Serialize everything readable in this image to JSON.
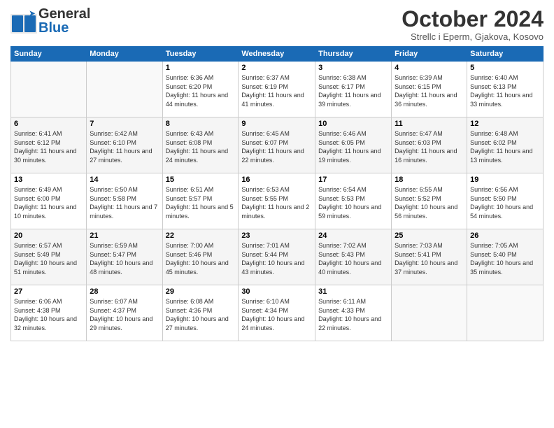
{
  "header": {
    "logo_main": "General",
    "logo_sub": "Blue",
    "month": "October 2024",
    "location": "Strellc i Eperm, Gjakova, Kosovo"
  },
  "days_of_week": [
    "Sunday",
    "Monday",
    "Tuesday",
    "Wednesday",
    "Thursday",
    "Friday",
    "Saturday"
  ],
  "weeks": [
    [
      {
        "day": "",
        "sunrise": "",
        "sunset": "",
        "daylight": ""
      },
      {
        "day": "",
        "sunrise": "",
        "sunset": "",
        "daylight": ""
      },
      {
        "day": "1",
        "sunrise": "Sunrise: 6:36 AM",
        "sunset": "Sunset: 6:20 PM",
        "daylight": "Daylight: 11 hours and 44 minutes."
      },
      {
        "day": "2",
        "sunrise": "Sunrise: 6:37 AM",
        "sunset": "Sunset: 6:19 PM",
        "daylight": "Daylight: 11 hours and 41 minutes."
      },
      {
        "day": "3",
        "sunrise": "Sunrise: 6:38 AM",
        "sunset": "Sunset: 6:17 PM",
        "daylight": "Daylight: 11 hours and 39 minutes."
      },
      {
        "day": "4",
        "sunrise": "Sunrise: 6:39 AM",
        "sunset": "Sunset: 6:15 PM",
        "daylight": "Daylight: 11 hours and 36 minutes."
      },
      {
        "day": "5",
        "sunrise": "Sunrise: 6:40 AM",
        "sunset": "Sunset: 6:13 PM",
        "daylight": "Daylight: 11 hours and 33 minutes."
      }
    ],
    [
      {
        "day": "6",
        "sunrise": "Sunrise: 6:41 AM",
        "sunset": "Sunset: 6:12 PM",
        "daylight": "Daylight: 11 hours and 30 minutes."
      },
      {
        "day": "7",
        "sunrise": "Sunrise: 6:42 AM",
        "sunset": "Sunset: 6:10 PM",
        "daylight": "Daylight: 11 hours and 27 minutes."
      },
      {
        "day": "8",
        "sunrise": "Sunrise: 6:43 AM",
        "sunset": "Sunset: 6:08 PM",
        "daylight": "Daylight: 11 hours and 24 minutes."
      },
      {
        "day": "9",
        "sunrise": "Sunrise: 6:45 AM",
        "sunset": "Sunset: 6:07 PM",
        "daylight": "Daylight: 11 hours and 22 minutes."
      },
      {
        "day": "10",
        "sunrise": "Sunrise: 6:46 AM",
        "sunset": "Sunset: 6:05 PM",
        "daylight": "Daylight: 11 hours and 19 minutes."
      },
      {
        "day": "11",
        "sunrise": "Sunrise: 6:47 AM",
        "sunset": "Sunset: 6:03 PM",
        "daylight": "Daylight: 11 hours and 16 minutes."
      },
      {
        "day": "12",
        "sunrise": "Sunrise: 6:48 AM",
        "sunset": "Sunset: 6:02 PM",
        "daylight": "Daylight: 11 hours and 13 minutes."
      }
    ],
    [
      {
        "day": "13",
        "sunrise": "Sunrise: 6:49 AM",
        "sunset": "Sunset: 6:00 PM",
        "daylight": "Daylight: 11 hours and 10 minutes."
      },
      {
        "day": "14",
        "sunrise": "Sunrise: 6:50 AM",
        "sunset": "Sunset: 5:58 PM",
        "daylight": "Daylight: 11 hours and 7 minutes."
      },
      {
        "day": "15",
        "sunrise": "Sunrise: 6:51 AM",
        "sunset": "Sunset: 5:57 PM",
        "daylight": "Daylight: 11 hours and 5 minutes."
      },
      {
        "day": "16",
        "sunrise": "Sunrise: 6:53 AM",
        "sunset": "Sunset: 5:55 PM",
        "daylight": "Daylight: 11 hours and 2 minutes."
      },
      {
        "day": "17",
        "sunrise": "Sunrise: 6:54 AM",
        "sunset": "Sunset: 5:53 PM",
        "daylight": "Daylight: 10 hours and 59 minutes."
      },
      {
        "day": "18",
        "sunrise": "Sunrise: 6:55 AM",
        "sunset": "Sunset: 5:52 PM",
        "daylight": "Daylight: 10 hours and 56 minutes."
      },
      {
        "day": "19",
        "sunrise": "Sunrise: 6:56 AM",
        "sunset": "Sunset: 5:50 PM",
        "daylight": "Daylight: 10 hours and 54 minutes."
      }
    ],
    [
      {
        "day": "20",
        "sunrise": "Sunrise: 6:57 AM",
        "sunset": "Sunset: 5:49 PM",
        "daylight": "Daylight: 10 hours and 51 minutes."
      },
      {
        "day": "21",
        "sunrise": "Sunrise: 6:59 AM",
        "sunset": "Sunset: 5:47 PM",
        "daylight": "Daylight: 10 hours and 48 minutes."
      },
      {
        "day": "22",
        "sunrise": "Sunrise: 7:00 AM",
        "sunset": "Sunset: 5:46 PM",
        "daylight": "Daylight: 10 hours and 45 minutes."
      },
      {
        "day": "23",
        "sunrise": "Sunrise: 7:01 AM",
        "sunset": "Sunset: 5:44 PM",
        "daylight": "Daylight: 10 hours and 43 minutes."
      },
      {
        "day": "24",
        "sunrise": "Sunrise: 7:02 AM",
        "sunset": "Sunset: 5:43 PM",
        "daylight": "Daylight: 10 hours and 40 minutes."
      },
      {
        "day": "25",
        "sunrise": "Sunrise: 7:03 AM",
        "sunset": "Sunset: 5:41 PM",
        "daylight": "Daylight: 10 hours and 37 minutes."
      },
      {
        "day": "26",
        "sunrise": "Sunrise: 7:05 AM",
        "sunset": "Sunset: 5:40 PM",
        "daylight": "Daylight: 10 hours and 35 minutes."
      }
    ],
    [
      {
        "day": "27",
        "sunrise": "Sunrise: 6:06 AM",
        "sunset": "Sunset: 4:38 PM",
        "daylight": "Daylight: 10 hours and 32 minutes."
      },
      {
        "day": "28",
        "sunrise": "Sunrise: 6:07 AM",
        "sunset": "Sunset: 4:37 PM",
        "daylight": "Daylight: 10 hours and 29 minutes."
      },
      {
        "day": "29",
        "sunrise": "Sunrise: 6:08 AM",
        "sunset": "Sunset: 4:36 PM",
        "daylight": "Daylight: 10 hours and 27 minutes."
      },
      {
        "day": "30",
        "sunrise": "Sunrise: 6:10 AM",
        "sunset": "Sunset: 4:34 PM",
        "daylight": "Daylight: 10 hours and 24 minutes."
      },
      {
        "day": "31",
        "sunrise": "Sunrise: 6:11 AM",
        "sunset": "Sunset: 4:33 PM",
        "daylight": "Daylight: 10 hours and 22 minutes."
      },
      {
        "day": "",
        "sunrise": "",
        "sunset": "",
        "daylight": ""
      },
      {
        "day": "",
        "sunrise": "",
        "sunset": "",
        "daylight": ""
      }
    ]
  ]
}
